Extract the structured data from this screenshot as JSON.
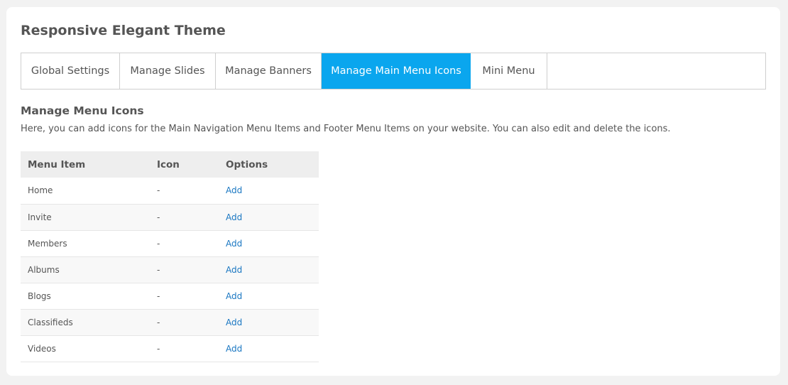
{
  "page": {
    "title": "Responsive Elegant Theme"
  },
  "tabs": [
    {
      "label": "Global Settings",
      "active": false
    },
    {
      "label": "Manage Slides",
      "active": false
    },
    {
      "label": "Manage Banners",
      "active": false
    },
    {
      "label": "Manage Main Menu Icons",
      "active": true
    },
    {
      "label": "Mini Menu",
      "active": false
    }
  ],
  "section": {
    "title": "Manage Menu Icons",
    "description": "Here, you can add icons for the Main Navigation Menu Items and Footer Menu Items on your website. You can also edit and delete the icons."
  },
  "table": {
    "headers": [
      "Menu Item",
      "Icon",
      "Options"
    ],
    "rows": [
      {
        "item": "Home",
        "icon": "-",
        "option": "Add"
      },
      {
        "item": "Invite",
        "icon": "-",
        "option": "Add"
      },
      {
        "item": "Members",
        "icon": "-",
        "option": "Add"
      },
      {
        "item": "Albums",
        "icon": "-",
        "option": "Add"
      },
      {
        "item": "Blogs",
        "icon": "-",
        "option": "Add"
      },
      {
        "item": "Classifieds",
        "icon": "-",
        "option": "Add"
      },
      {
        "item": "Videos",
        "icon": "-",
        "option": "Add"
      }
    ]
  },
  "colors": {
    "accent": "#0aa6ee",
    "link": "#1a77c2",
    "background": "#f2f2f2"
  }
}
